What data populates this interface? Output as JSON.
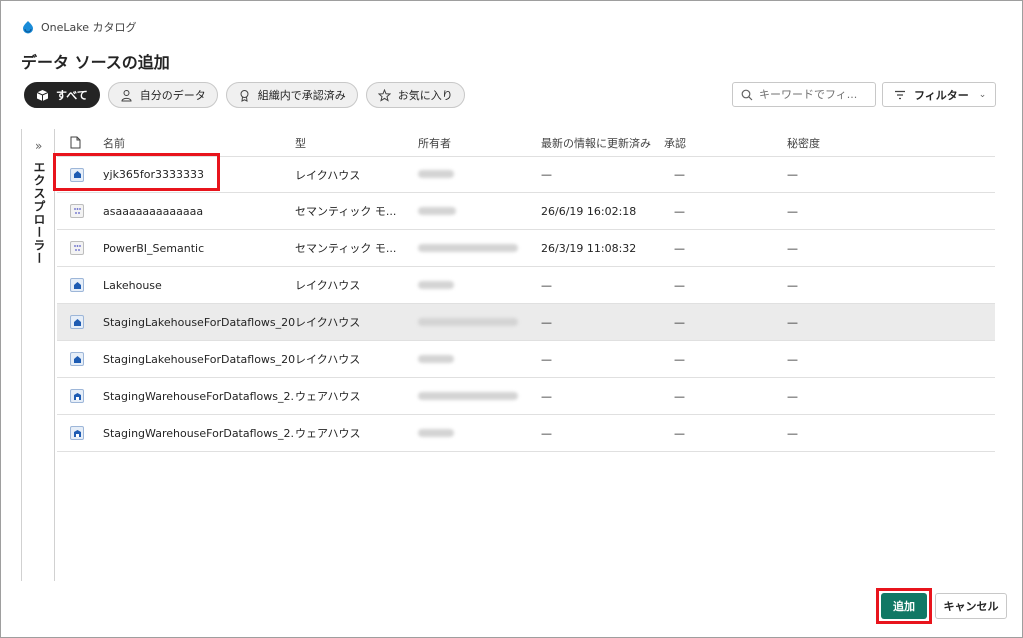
{
  "header": {
    "app_name": "OneLake カタログ",
    "page_title": "データ ソースの追加"
  },
  "pills": [
    {
      "label": "すべて",
      "icon": "cube-icon",
      "active": true
    },
    {
      "label": "自分のデータ",
      "icon": "person-icon",
      "active": false
    },
    {
      "label": "組織内で承認済み",
      "icon": "badge-icon",
      "active": false
    },
    {
      "label": "お気に入り",
      "icon": "star-icon",
      "active": false
    }
  ],
  "search": {
    "placeholder": "キーワードでフィ..."
  },
  "filter": {
    "label": "フィルター"
  },
  "explorer": {
    "label": "エクスプローラー"
  },
  "table": {
    "columns": {
      "name": "名前",
      "type": "型",
      "owner": "所有者",
      "updated": "最新の情報に更新済み",
      "endorsement": "承認",
      "sensitivity": "秘密度"
    },
    "rows": [
      {
        "icon": "lakehouse-icon",
        "name": "yjk365for3333333",
        "type": "レイクハウス",
        "updated": "—",
        "endorsement": "—",
        "sensitivity": "—"
      },
      {
        "icon": "semantic-model-icon",
        "name": "asaaaaaaaaaaaaa",
        "type": "セマンティック モ...",
        "updated": "26/6/19 16:02:18",
        "endorsement": "—",
        "sensitivity": "—"
      },
      {
        "icon": "semantic-model-icon",
        "name": "PowerBI_Semantic",
        "type": "セマンティック モ...",
        "updated": "26/3/19 11:08:32",
        "endorsement": "—",
        "sensitivity": "—"
      },
      {
        "icon": "lakehouse-icon",
        "name": "Lakehouse",
        "type": "レイクハウス",
        "updated": "—",
        "endorsement": "—",
        "sensitivity": "—"
      },
      {
        "icon": "lakehouse-icon",
        "name": "StagingLakehouseForDataflows_20...",
        "type": "レイクハウス",
        "updated": "—",
        "endorsement": "—",
        "sensitivity": "—"
      },
      {
        "icon": "lakehouse-icon",
        "name": "StagingLakehouseForDataflows_20...",
        "type": "レイクハウス",
        "updated": "—",
        "endorsement": "—",
        "sensitivity": "—"
      },
      {
        "icon": "warehouse-icon",
        "name": "StagingWarehouseForDataflows_2...",
        "type": "ウェアハウス",
        "updated": "—",
        "endorsement": "—",
        "sensitivity": "—"
      },
      {
        "icon": "warehouse-icon",
        "name": "StagingWarehouseForDataflows_2...",
        "type": "ウェアハウス",
        "updated": "—",
        "endorsement": "—",
        "sensitivity": "—"
      }
    ]
  },
  "footer": {
    "add_label": "追加",
    "cancel_label": "キャンセル"
  },
  "colors": {
    "primary": "#117865",
    "highlight": "#e8141c",
    "active_pill": "#242424"
  }
}
